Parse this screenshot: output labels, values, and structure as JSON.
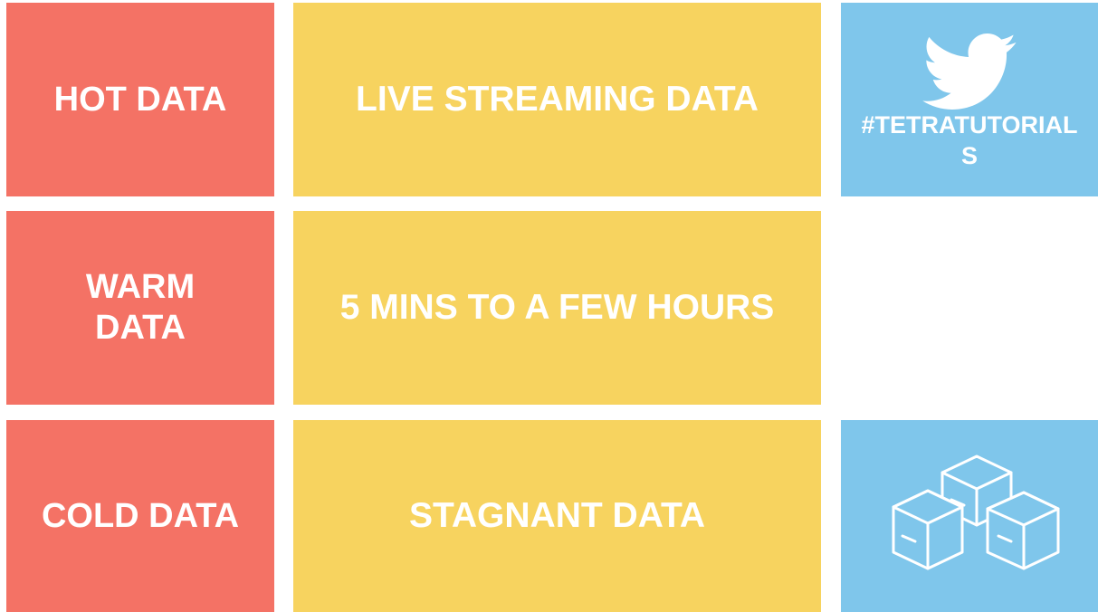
{
  "colors": {
    "red": "#F47265",
    "yellow": "#F7D35F",
    "blue": "#7FC6EB",
    "text": "#FFFFFF"
  },
  "rows": [
    {
      "category": "HOT DATA",
      "description": "LIVE STREAMING DATA"
    },
    {
      "category": "WARM\nDATA",
      "description": "5 MINS TO A FEW HOURS"
    },
    {
      "category": "COLD DATA",
      "description": "STAGNANT DATA"
    }
  ],
  "social": {
    "icon": "twitter-bird-icon",
    "hashtag": "#TETRATUTORIAL\nS"
  },
  "storage": {
    "icon": "stacked-boxes-icon"
  }
}
